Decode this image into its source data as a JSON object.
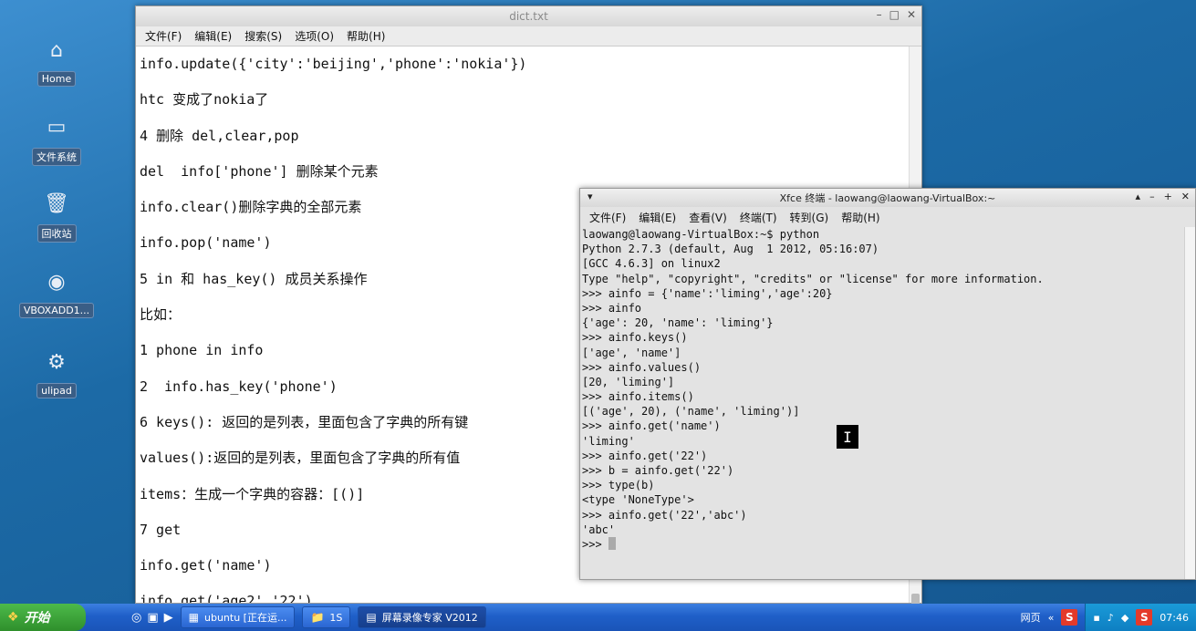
{
  "desktop": {
    "icons": [
      {
        "label": "Home",
        "icon": "home-icon"
      },
      {
        "label": "文件系统",
        "icon": "drive-icon"
      },
      {
        "label": "回收站",
        "icon": "trash-icon"
      },
      {
        "label": "VBOXADD1...",
        "icon": "disc-icon"
      },
      {
        "label": "ulipad",
        "icon": "gear-icon"
      }
    ]
  },
  "editor": {
    "title": "dict.txt",
    "menu": [
      "文件(F)",
      "编辑(E)",
      "搜索(S)",
      "选项(O)",
      "帮助(H)"
    ],
    "lines": [
      "info.update({'city':'beijing','phone':'nokia'})",
      "htc 变成了nokia了",
      "4 删除 del,clear,pop",
      "del  info['phone'] 删除某个元素",
      "info.clear()删除字典的全部元素",
      "info.pop('name')",
      "5 in 和 has_key() 成员关系操作",
      "比如：",
      "1 phone in info",
      "2  info.has_key('phone')",
      "6 keys(): 返回的是列表，里面包含了字典的所有键",
      "values():返回的是列表，里面包含了字典的所有值",
      "items：生成一个字典的容器：[()]",
      "7 get",
      "info.get('name')",
      "info.get('age2','22')"
    ]
  },
  "terminal": {
    "title": "Xfce 终端 - laowang@laowang-VirtualBox:~",
    "menu": [
      "文件(F)",
      "编辑(E)",
      "查看(V)",
      "终端(T)",
      "转到(G)",
      "帮助(H)"
    ],
    "lines": [
      "laowang@laowang-VirtualBox:~$ python",
      "Python 2.7.3 (default, Aug  1 2012, 05:16:07)",
      "[GCC 4.6.3] on linux2",
      "Type \"help\", \"copyright\", \"credits\" or \"license\" for more information.",
      ">>> ainfo = {'name':'liming','age':20}",
      ">>> ainfo",
      "{'age': 20, 'name': 'liming'}",
      ">>> ainfo.keys()",
      "['age', 'name']",
      ">>> ainfo.values()",
      "[20, 'liming']",
      ">>> ainfo.items()",
      "[('age', 20), ('name', 'liming')]",
      ">>> ainfo.get('name')",
      "'liming'",
      ">>> ainfo.get('22')",
      ">>> b = ainfo.get('22')",
      ">>> type(b)",
      "<type 'NoneType'>",
      ">>> ainfo.get('22','abc')",
      "'abc'"
    ],
    "prompt": ">>> "
  },
  "taskbar": {
    "start_label": "开始",
    "tasks": [
      {
        "label": "ubuntu [正在运...",
        "icon": "virtualbox-icon",
        "active": false
      },
      {
        "label": "1S",
        "icon": "folder-icon",
        "active": false
      },
      {
        "label": "屏幕录像专家 V2012",
        "icon": "recorder-icon",
        "active": true
      }
    ],
    "tray_text": "网页",
    "clock": "07:46"
  },
  "colors": {
    "desktop": "#1c6aa6",
    "taskbar": "#1f5fc8",
    "start": "#2f8f2c"
  }
}
